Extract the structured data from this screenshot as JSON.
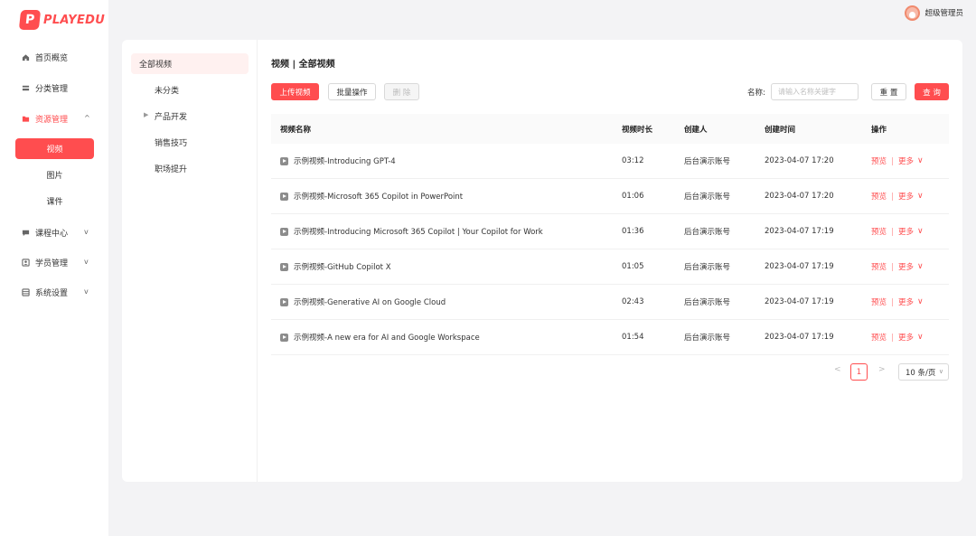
{
  "brand": {
    "logo_letter": "P",
    "name": "PLAYEDU",
    "accent": "#ff4d4f"
  },
  "header": {
    "user_name": "超级管理员"
  },
  "sidebar": {
    "items": [
      {
        "label": "首页概览",
        "icon": "home-icon"
      },
      {
        "label": "分类管理",
        "icon": "category-icon"
      },
      {
        "label": "资源管理",
        "icon": "folder-icon",
        "chevron": "^"
      },
      {
        "label": "课程中心",
        "icon": "course-icon",
        "chevron": "v"
      },
      {
        "label": "学员管理",
        "icon": "user-icon",
        "chevron": "v"
      },
      {
        "label": "系统设置",
        "icon": "settings-icon",
        "chevron": "v"
      }
    ],
    "sub_items": [
      {
        "label": "视频"
      },
      {
        "label": "图片"
      },
      {
        "label": "课件"
      }
    ]
  },
  "categories": [
    {
      "label": "全部视频"
    },
    {
      "label": "未分类"
    },
    {
      "label": "产品开发",
      "caret": "▶"
    },
    {
      "label": "销售技巧"
    },
    {
      "label": "职场提升"
    }
  ],
  "main": {
    "title": "视频 | 全部视频",
    "toolbar": {
      "upload_label": "上传视频",
      "batch_label": "批量操作",
      "delete_label": "删 除",
      "search_label": "名称:",
      "search_placeholder": "请输入名称关键字",
      "reset_label": "重 置",
      "query_label": "查 询"
    },
    "table": {
      "headers": [
        "视频名称",
        "视频时长",
        "创建人",
        "创建时间",
        "操作"
      ],
      "rows": [
        {
          "name": "示例视频-Introducing GPT-4",
          "duration": "03:12",
          "creator": "后台演示账号",
          "time": "2023-04-07 17:20"
        },
        {
          "name": "示例视频-Microsoft 365 Copilot in PowerPoint",
          "duration": "01:06",
          "creator": "后台演示账号",
          "time": "2023-04-07 17:20"
        },
        {
          "name": "示例视频-Introducing Microsoft 365 Copilot | Your Copilot for Work",
          "duration": "01:36",
          "creator": "后台演示账号",
          "time": "2023-04-07 17:19"
        },
        {
          "name": "示例视频-GitHub Copilot X",
          "duration": "01:05",
          "creator": "后台演示账号",
          "time": "2023-04-07 17:19"
        },
        {
          "name": "示例视频-Generative AI on Google Cloud",
          "duration": "02:43",
          "creator": "后台演示账号",
          "time": "2023-04-07 17:19"
        },
        {
          "name": "示例视频-A new era for AI and Google Workspace",
          "duration": "01:54",
          "creator": "后台演示账号",
          "time": "2023-04-07 17:19"
        }
      ],
      "op_preview": "预览",
      "op_more": "更多",
      "op_more_chevron": "∨"
    },
    "pagination": {
      "prev": "<",
      "next": ">",
      "current_page": "1",
      "page_size": "10 条/页",
      "size_chevron": "∨"
    }
  }
}
